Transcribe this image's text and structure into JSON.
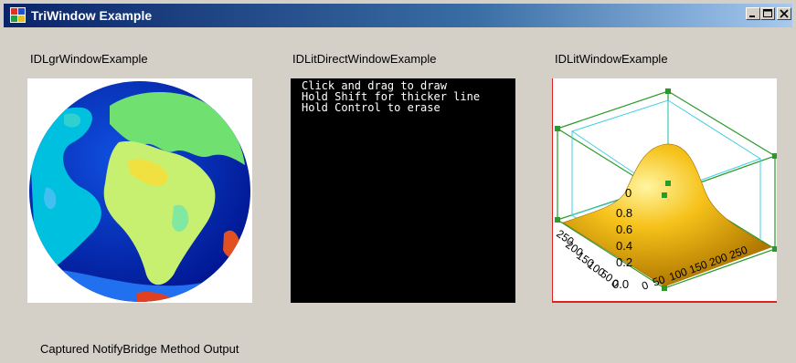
{
  "window": {
    "title": "TriWindow Example",
    "controls": {
      "minimize": "_",
      "maximize": "□",
      "close": "×"
    }
  },
  "panels": [
    {
      "label": "IDLgrWindowExample"
    },
    {
      "label": "IDLitDirectWindowExample",
      "instructions": [
        "Click and drag to draw",
        "Hold Shift for thicker line",
        "Hold Control to erase"
      ]
    },
    {
      "label": "IDLitWindowExample",
      "z_ticks": [
        "0",
        "0.8",
        "0.6",
        "0.4",
        "0.2",
        "0.0"
      ],
      "x_ticks": [
        "0",
        "50",
        "100",
        "150",
        "200",
        "250"
      ],
      "y_ticks": [
        "250",
        "200",
        "150",
        "100",
        "50",
        "0"
      ]
    }
  ],
  "output": {
    "label": "Captured NotifyBridge Method Output"
  },
  "colors": {
    "title_gradient_start": "#0a246a",
    "title_gradient_end": "#a6caf0",
    "surface": "#f0c020",
    "box": "#2a9a2a",
    "inner_box": "#40d0e0"
  },
  "icons": {
    "app": "window-app-icon"
  }
}
